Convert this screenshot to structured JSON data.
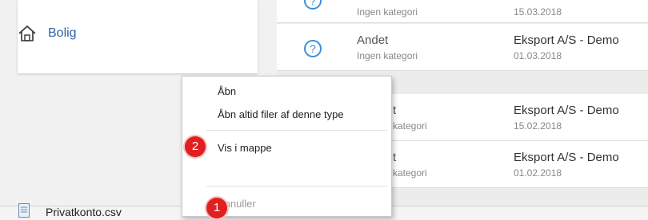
{
  "sidebar": {
    "item_label": "Bolig"
  },
  "list": {
    "top_partial": {
      "category": "Ingen kategori",
      "date": "15.03.2018"
    },
    "rows": [
      {
        "name": "Andet",
        "category": "Ingen kategori",
        "company": "Eksport A/S - Demo",
        "date": "01.03.2018"
      },
      {
        "name": "Andet",
        "category": "Ingen kategori",
        "company": "Eksport A/S - Demo",
        "date": "15.02.2018"
      },
      {
        "name": "Andet",
        "category": "Ingen kategori",
        "company": "Eksport A/S - Demo",
        "date": "01.02.2018"
      }
    ],
    "hidden_name_suffix": "t",
    "hidden_category_suffix": "kategori"
  },
  "context_menu": {
    "open": "Åbn",
    "always_open": "Åbn altid filer af denne type",
    "show_in_folder": "Vis i mappe",
    "cancel": "Annuller"
  },
  "download_bar": {
    "file_name": "Privatkonto.csv"
  },
  "badges": {
    "first": "1",
    "second": "2"
  },
  "colors": {
    "accent": "#3d8fd8",
    "badge": "#e02020",
    "link": "#2a64a8"
  }
}
